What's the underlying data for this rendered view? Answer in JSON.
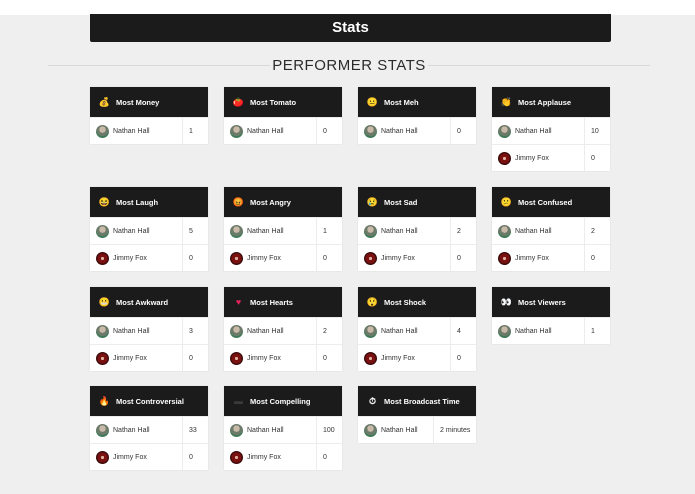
{
  "header": {
    "title": "Stats"
  },
  "section": {
    "title": "PERFORMER STATS"
  },
  "cards": [
    {
      "title": "Most Money",
      "icon": "money-bag-icon",
      "glyph": "💰",
      "color": "#f4c14b",
      "rows": [
        {
          "name": "Nathan Hall",
          "avatar": "nathan",
          "value": "1"
        }
      ]
    },
    {
      "title": "Most Tomato",
      "icon": "tomato-icon",
      "glyph": "🍅",
      "color": "#e23b2a",
      "rows": [
        {
          "name": "Nathan Hall",
          "avatar": "nathan",
          "value": "0"
        }
      ]
    },
    {
      "title": "Most Meh",
      "icon": "meh-face-icon",
      "glyph": "😐",
      "color": "#f7c948",
      "rows": [
        {
          "name": "Nathan Hall",
          "avatar": "nathan",
          "value": "0"
        }
      ]
    },
    {
      "title": "Most Applause",
      "icon": "clapping-hands-icon",
      "glyph": "👏",
      "color": "#f5c542",
      "rows": [
        {
          "name": "Nathan Hall",
          "avatar": "nathan",
          "value": "10"
        },
        {
          "name": "Jimmy Fox",
          "avatar": "jimmy",
          "value": "0"
        }
      ]
    },
    {
      "title": "Most Laugh",
      "icon": "laughing-face-icon",
      "glyph": "😆",
      "color": "#f7c948",
      "rows": [
        {
          "name": "Nathan Hall",
          "avatar": "nathan",
          "value": "5"
        },
        {
          "name": "Jimmy Fox",
          "avatar": "jimmy",
          "value": "0"
        }
      ]
    },
    {
      "title": "Most Angry",
      "icon": "angry-face-icon",
      "glyph": "😡",
      "color": "#d9344a",
      "rows": [
        {
          "name": "Nathan Hall",
          "avatar": "nathan",
          "value": "1"
        },
        {
          "name": "Jimmy Fox",
          "avatar": "jimmy",
          "value": "0"
        }
      ]
    },
    {
      "title": "Most Sad",
      "icon": "sad-face-icon",
      "glyph": "😢",
      "color": "#f7c948",
      "rows": [
        {
          "name": "Nathan Hall",
          "avatar": "nathan",
          "value": "2"
        },
        {
          "name": "Jimmy Fox",
          "avatar": "jimmy",
          "value": "0"
        }
      ]
    },
    {
      "title": "Most Confused",
      "icon": "confused-face-icon",
      "glyph": "😕",
      "color": "#f7c948",
      "rows": [
        {
          "name": "Nathan Hall",
          "avatar": "nathan",
          "value": "2"
        },
        {
          "name": "Jimmy Fox",
          "avatar": "jimmy",
          "value": "0"
        }
      ]
    },
    {
      "title": "Most Awkward",
      "icon": "grimacing-face-icon",
      "glyph": "😬",
      "color": "#f7c948",
      "rows": [
        {
          "name": "Nathan Hall",
          "avatar": "nathan",
          "value": "3"
        },
        {
          "name": "Jimmy Fox",
          "avatar": "jimmy",
          "value": "0"
        }
      ]
    },
    {
      "title": "Most Hearts",
      "icon": "heart-icon",
      "glyph": "♥",
      "color": "#e0245e",
      "rows": [
        {
          "name": "Nathan Hall",
          "avatar": "nathan",
          "value": "2"
        },
        {
          "name": "Jimmy Fox",
          "avatar": "jimmy",
          "value": "0"
        }
      ]
    },
    {
      "title": "Most Shock",
      "icon": "shocked-face-icon",
      "glyph": "😲",
      "color": "#f7c948",
      "rows": [
        {
          "name": "Nathan Hall",
          "avatar": "nathan",
          "value": "4"
        },
        {
          "name": "Jimmy Fox",
          "avatar": "jimmy",
          "value": "0"
        }
      ]
    },
    {
      "title": "Most Viewers",
      "icon": "eyes-icon",
      "glyph": "👀",
      "color": "#ffffff",
      "rows": [
        {
          "name": "Nathan Hall",
          "avatar": "nathan",
          "value": "1"
        }
      ]
    },
    {
      "title": "Most Controversial",
      "icon": "fire-icon",
      "glyph": "🔥",
      "color": "#f58a1f",
      "rows": [
        {
          "name": "Nathan Hall",
          "avatar": "nathan",
          "value": "33"
        },
        {
          "name": "Jimmy Fox",
          "avatar": "jimmy",
          "value": "0"
        }
      ]
    },
    {
      "title": "Most Compelling",
      "icon": "compelling-icon",
      "glyph": "▬",
      "color": "#3a3a3a",
      "rows": [
        {
          "name": "Nathan Hall",
          "avatar": "nathan",
          "value": "100"
        },
        {
          "name": "Jimmy Fox",
          "avatar": "jimmy",
          "value": "0"
        }
      ]
    },
    {
      "title": "Most Broadcast Time",
      "icon": "stopwatch-icon",
      "glyph": "⏱",
      "color": "#ffffff",
      "rows": [
        {
          "name": "Nathan Hall",
          "avatar": "nathan",
          "value": "2 minutes"
        }
      ]
    }
  ]
}
